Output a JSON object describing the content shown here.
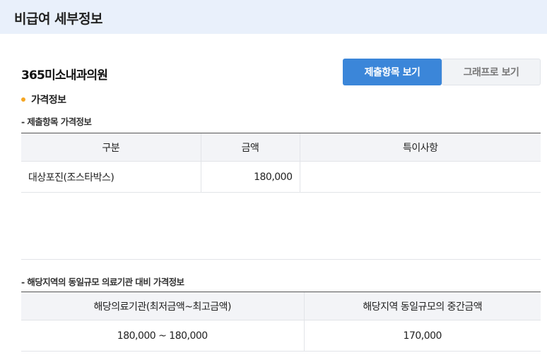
{
  "header": {
    "title": "비급여 세부정보"
  },
  "clinic": {
    "name": "365미소내과의원"
  },
  "tabs": [
    {
      "label": "제출항목 보기",
      "active": true
    },
    {
      "label": "그래프로 보기",
      "active": false
    }
  ],
  "section": {
    "title": "가격정보"
  },
  "price_table": {
    "caption": "- 제출항목 가격정보",
    "headers": [
      "구분",
      "금액",
      "특이사항"
    ],
    "rows": [
      [
        "대상포진(조스타박스)",
        "180,000",
        ""
      ]
    ]
  },
  "compare_table": {
    "caption": "- 해당지역의 동일규모 의료기관 대비 가격정보",
    "headers": [
      "해당의료기관(최저금액~최고금액)",
      "해당지역 동일규모의 중간금액"
    ],
    "rows": [
      [
        "180,000 ~ 180,000",
        "170,000"
      ]
    ]
  },
  "colors": {
    "header_bg": "#e9f0fb",
    "accent": "#3b86d9",
    "dot": "#f5a623"
  }
}
